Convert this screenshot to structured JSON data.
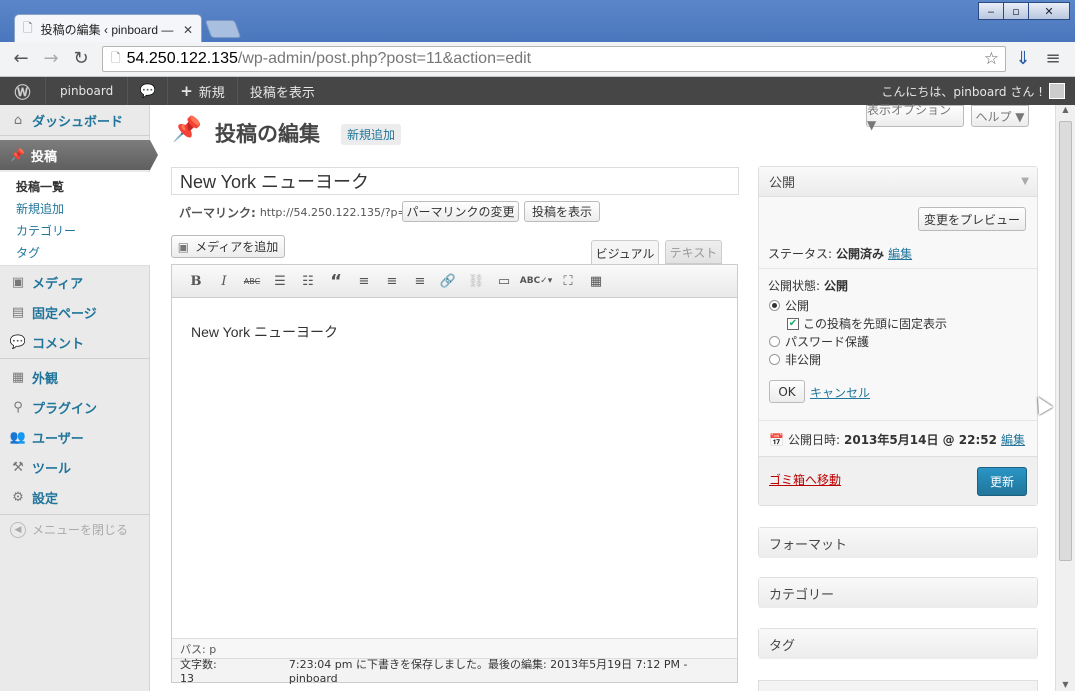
{
  "browser": {
    "tab_title": "投稿の編集 ‹ pinboard —",
    "url_host": "54.250.122.135",
    "url_path": "/wp-admin/post.php?post=11&action=edit"
  },
  "adminbar": {
    "site_name": "pinboard",
    "new_label": "新規",
    "view_post_label": "投稿を表示",
    "greeting": "こんにちは、pinboard さん !"
  },
  "sidebar": {
    "dashboard": "ダッシュボード",
    "posts": "投稿",
    "posts_sub": [
      "投稿一覧",
      "新規追加",
      "カテゴリー",
      "タグ"
    ],
    "media": "メディア",
    "pages": "固定ページ",
    "comments": "コメント",
    "appearance": "外観",
    "plugins": "プラグイン",
    "users": "ユーザー",
    "tools": "ツール",
    "settings": "設定",
    "collapse": "メニューを閉じる"
  },
  "screen_meta": {
    "screen_options": "表示オプション ▼",
    "help": "ヘルプ ▼"
  },
  "main": {
    "page_title": "投稿の編集",
    "add_new": "新規追加",
    "post_title": "New York ニューヨーク",
    "permalink_label": "パーマリンク:",
    "permalink_url": "http://54.250.122.135/?p=11",
    "change_permalink": "パーマリンクの変更",
    "view_post": "投稿を表示",
    "add_media": "メディアを追加",
    "tab_visual": "ビジュアル",
    "tab_text": "テキスト",
    "content": "New York ニューヨーク",
    "path": "パス: p",
    "word_count": "文字数: 13",
    "autosave": "7:23:04 pm に下書きを保存しました。最後の編集: 2013年5月19日 7:12 PM - pinboard"
  },
  "publish": {
    "heading": "公開",
    "preview_button": "変更をプレビュー",
    "status_label": "ステータス:",
    "status_value": "公開済み",
    "edit": "編集",
    "visibility_label": "公開状態:",
    "visibility_value": "公開",
    "option_public": "公開",
    "sticky": "この投稿を先頭に固定表示",
    "option_password": "パスワード保護",
    "option_private": "非公開",
    "ok": "OK",
    "cancel": "キャンセル",
    "date_label": "公開日時:",
    "date_value": "2013年5月14日 @ 22:52",
    "trash": "ゴミ箱へ移動",
    "update": "更新"
  },
  "boxes": {
    "format": "フォーマット",
    "category": "カテゴリー",
    "tags": "タグ"
  }
}
